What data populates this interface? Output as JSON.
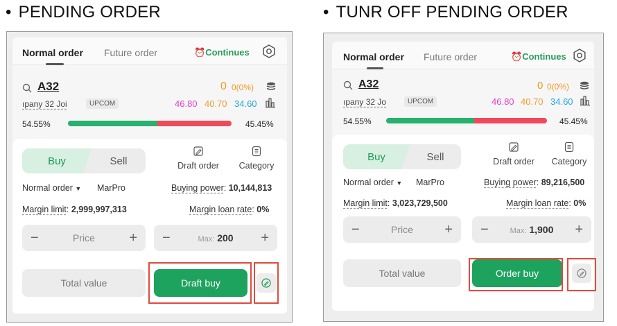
{
  "left": {
    "heading": "PENDING ORDER",
    "tabs": {
      "normal": "Normal order",
      "future": "Future order",
      "continues": "Continues"
    },
    "symbol": "A32",
    "change_main": "0",
    "change_pct": "0(0%)",
    "company": "ıpany  32 Joi",
    "exchange": "UPCOM",
    "price_ceiling": "46.80",
    "price_ref": "40.70",
    "price_floor": "34.60",
    "buy_pct": "54.55%",
    "sell_pct": "45.45%",
    "buy_fraction": 0.5455,
    "buy_label": "Buy",
    "sell_label": "Sell",
    "draft_order": "Draft order",
    "category": "Category",
    "order_type": "Normal order",
    "marpro": "MarPro",
    "buying_power_label": "Buying power",
    "buying_power": "10,144,813",
    "margin_limit_label": "Margin limit",
    "margin_limit": "2,999,997,313",
    "margin_rate_label": "Margin loan rate",
    "margin_rate": "0%",
    "price_placeholder": "Price",
    "max_label": "Max:",
    "max_value": "200",
    "minus": "−",
    "plus": "+",
    "total_value": "Total value",
    "action_button": "Draft buy"
  },
  "right": {
    "heading": "TUNR OFF PENDING ORDER",
    "tabs": {
      "normal": "Normal order",
      "future": "Future order",
      "continues": "Continues"
    },
    "symbol": "A32",
    "change_main": "0",
    "change_pct": "0(0%)",
    "company": "ıpany  32 Jo",
    "exchange": "UPCOM",
    "price_ceiling": "46.80",
    "price_ref": "40.70",
    "price_floor": "34.60",
    "buy_pct": "54.55%",
    "sell_pct": "45.45%",
    "buy_fraction": 0.5455,
    "buy_label": "Buy",
    "sell_label": "Sell",
    "draft_order": "Draft order",
    "category": "Category",
    "order_type": "Normal order",
    "marpro": "MarPro",
    "buying_power_label": "Buying power",
    "buying_power": "89,216,500",
    "margin_limit_label": "Margin limit",
    "margin_limit": "3,023,729,500",
    "margin_rate_label": "Margin loan rate",
    "margin_rate": "0%",
    "price_placeholder": "Price",
    "max_label": "Max:",
    "max_value": "1,900",
    "minus": "−",
    "plus": "+",
    "total_value": "Total value",
    "action_button": "Order buy"
  },
  "colors": {
    "accent_green": "#1ea35f",
    "highlight_red": "#e04b3c",
    "ceiling_pink": "#e23ec8",
    "ref_amber": "#f29b2c",
    "floor_blue": "#22a7d8"
  }
}
